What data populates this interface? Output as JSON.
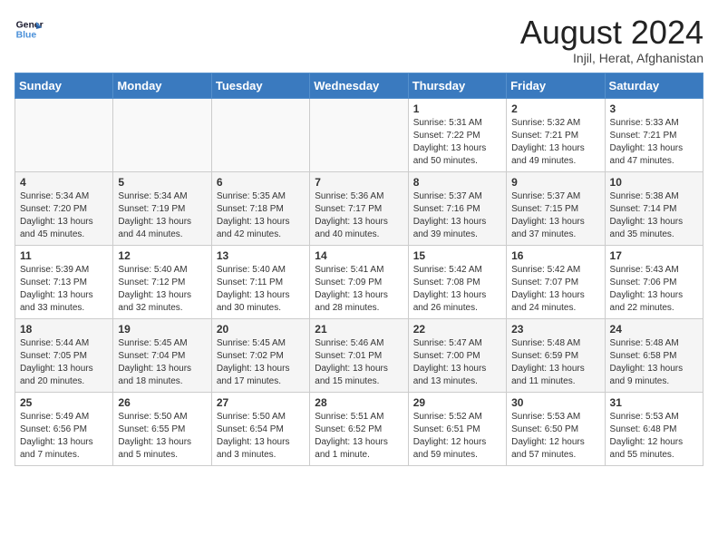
{
  "logo": {
    "line1": "General",
    "line2": "Blue"
  },
  "title": "August 2024",
  "subtitle": "Injil, Herat, Afghanistan",
  "weekdays": [
    "Sunday",
    "Monday",
    "Tuesday",
    "Wednesday",
    "Thursday",
    "Friday",
    "Saturday"
  ],
  "weeks": [
    [
      {
        "day": "",
        "info": ""
      },
      {
        "day": "",
        "info": ""
      },
      {
        "day": "",
        "info": ""
      },
      {
        "day": "",
        "info": ""
      },
      {
        "day": "1",
        "info": "Sunrise: 5:31 AM\nSunset: 7:22 PM\nDaylight: 13 hours\nand 50 minutes."
      },
      {
        "day": "2",
        "info": "Sunrise: 5:32 AM\nSunset: 7:21 PM\nDaylight: 13 hours\nand 49 minutes."
      },
      {
        "day": "3",
        "info": "Sunrise: 5:33 AM\nSunset: 7:21 PM\nDaylight: 13 hours\nand 47 minutes."
      }
    ],
    [
      {
        "day": "4",
        "info": "Sunrise: 5:34 AM\nSunset: 7:20 PM\nDaylight: 13 hours\nand 45 minutes."
      },
      {
        "day": "5",
        "info": "Sunrise: 5:34 AM\nSunset: 7:19 PM\nDaylight: 13 hours\nand 44 minutes."
      },
      {
        "day": "6",
        "info": "Sunrise: 5:35 AM\nSunset: 7:18 PM\nDaylight: 13 hours\nand 42 minutes."
      },
      {
        "day": "7",
        "info": "Sunrise: 5:36 AM\nSunset: 7:17 PM\nDaylight: 13 hours\nand 40 minutes."
      },
      {
        "day": "8",
        "info": "Sunrise: 5:37 AM\nSunset: 7:16 PM\nDaylight: 13 hours\nand 39 minutes."
      },
      {
        "day": "9",
        "info": "Sunrise: 5:37 AM\nSunset: 7:15 PM\nDaylight: 13 hours\nand 37 minutes."
      },
      {
        "day": "10",
        "info": "Sunrise: 5:38 AM\nSunset: 7:14 PM\nDaylight: 13 hours\nand 35 minutes."
      }
    ],
    [
      {
        "day": "11",
        "info": "Sunrise: 5:39 AM\nSunset: 7:13 PM\nDaylight: 13 hours\nand 33 minutes."
      },
      {
        "day": "12",
        "info": "Sunrise: 5:40 AM\nSunset: 7:12 PM\nDaylight: 13 hours\nand 32 minutes."
      },
      {
        "day": "13",
        "info": "Sunrise: 5:40 AM\nSunset: 7:11 PM\nDaylight: 13 hours\nand 30 minutes."
      },
      {
        "day": "14",
        "info": "Sunrise: 5:41 AM\nSunset: 7:09 PM\nDaylight: 13 hours\nand 28 minutes."
      },
      {
        "day": "15",
        "info": "Sunrise: 5:42 AM\nSunset: 7:08 PM\nDaylight: 13 hours\nand 26 minutes."
      },
      {
        "day": "16",
        "info": "Sunrise: 5:42 AM\nSunset: 7:07 PM\nDaylight: 13 hours\nand 24 minutes."
      },
      {
        "day": "17",
        "info": "Sunrise: 5:43 AM\nSunset: 7:06 PM\nDaylight: 13 hours\nand 22 minutes."
      }
    ],
    [
      {
        "day": "18",
        "info": "Sunrise: 5:44 AM\nSunset: 7:05 PM\nDaylight: 13 hours\nand 20 minutes."
      },
      {
        "day": "19",
        "info": "Sunrise: 5:45 AM\nSunset: 7:04 PM\nDaylight: 13 hours\nand 18 minutes."
      },
      {
        "day": "20",
        "info": "Sunrise: 5:45 AM\nSunset: 7:02 PM\nDaylight: 13 hours\nand 17 minutes."
      },
      {
        "day": "21",
        "info": "Sunrise: 5:46 AM\nSunset: 7:01 PM\nDaylight: 13 hours\nand 15 minutes."
      },
      {
        "day": "22",
        "info": "Sunrise: 5:47 AM\nSunset: 7:00 PM\nDaylight: 13 hours\nand 13 minutes."
      },
      {
        "day": "23",
        "info": "Sunrise: 5:48 AM\nSunset: 6:59 PM\nDaylight: 13 hours\nand 11 minutes."
      },
      {
        "day": "24",
        "info": "Sunrise: 5:48 AM\nSunset: 6:58 PM\nDaylight: 13 hours\nand 9 minutes."
      }
    ],
    [
      {
        "day": "25",
        "info": "Sunrise: 5:49 AM\nSunset: 6:56 PM\nDaylight: 13 hours\nand 7 minutes."
      },
      {
        "day": "26",
        "info": "Sunrise: 5:50 AM\nSunset: 6:55 PM\nDaylight: 13 hours\nand 5 minutes."
      },
      {
        "day": "27",
        "info": "Sunrise: 5:50 AM\nSunset: 6:54 PM\nDaylight: 13 hours\nand 3 minutes."
      },
      {
        "day": "28",
        "info": "Sunrise: 5:51 AM\nSunset: 6:52 PM\nDaylight: 13 hours\nand 1 minute."
      },
      {
        "day": "29",
        "info": "Sunrise: 5:52 AM\nSunset: 6:51 PM\nDaylight: 12 hours\nand 59 minutes."
      },
      {
        "day": "30",
        "info": "Sunrise: 5:53 AM\nSunset: 6:50 PM\nDaylight: 12 hours\nand 57 minutes."
      },
      {
        "day": "31",
        "info": "Sunrise: 5:53 AM\nSunset: 6:48 PM\nDaylight: 12 hours\nand 55 minutes."
      }
    ]
  ]
}
